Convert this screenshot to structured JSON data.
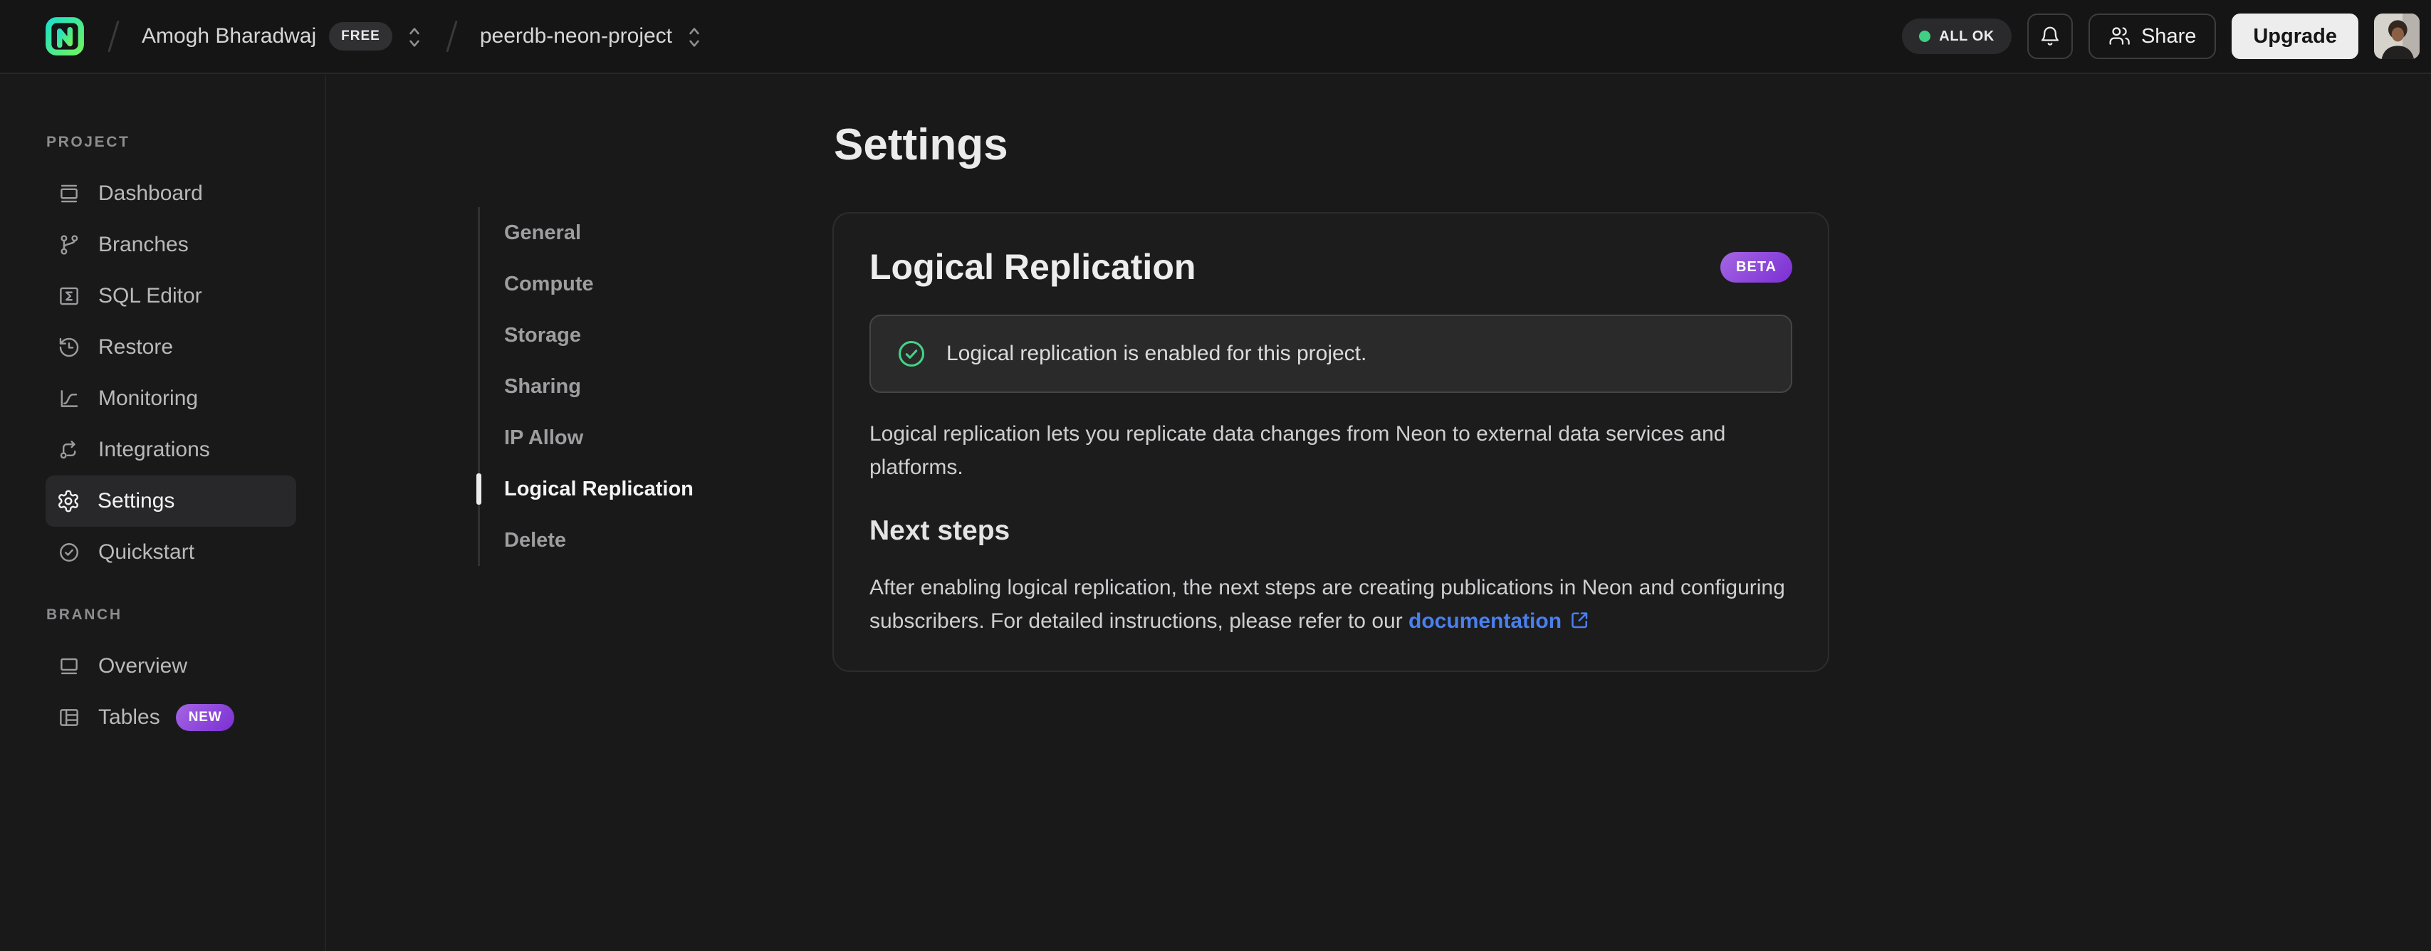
{
  "header": {
    "org_name": "Amogh Bharadwaj",
    "org_plan_badge": "FREE",
    "project_name": "peerdb-neon-project",
    "status_label": "ALL OK",
    "share_label": "Share",
    "upgrade_label": "Upgrade"
  },
  "sidebar": {
    "sections": [
      {
        "label": "PROJECT",
        "items": [
          {
            "label": "Dashboard"
          },
          {
            "label": "Branches"
          },
          {
            "label": "SQL Editor"
          },
          {
            "label": "Restore"
          },
          {
            "label": "Monitoring"
          },
          {
            "label": "Integrations"
          },
          {
            "label": "Settings"
          },
          {
            "label": "Quickstart"
          }
        ]
      },
      {
        "label": "BRANCH",
        "items": [
          {
            "label": "Overview"
          },
          {
            "label": "Tables",
            "badge": "NEW"
          }
        ]
      }
    ]
  },
  "settings_nav": {
    "items": [
      "General",
      "Compute",
      "Storage",
      "Sharing",
      "IP Allow",
      "Logical Replication",
      "Delete"
    ],
    "active": "Logical Replication"
  },
  "main": {
    "page_title": "Settings",
    "card": {
      "title": "Logical Replication",
      "badge": "BETA",
      "alert_text": "Logical replication is enabled for this project.",
      "description": "Logical replication lets you replicate data changes from Neon to external data services and platforms.",
      "next_steps_heading": "Next steps",
      "next_steps_text": "After enabling logical replication, the next steps are creating publications in Neon and configuring subscribers. For detailed instructions, please refer to our ",
      "doc_link_label": "documentation"
    }
  },
  "colors": {
    "success_green": "#42d483",
    "status_dot_green": "#41cf84",
    "badge_purple_start": "#a466e3",
    "badge_purple_end": "#7b2fd3",
    "link_blue": "#4a80ee",
    "upgrade_button_bg": "#ededee",
    "logo_gradient_start": "#1ee0c8",
    "logo_gradient_end": "#6ef35f"
  }
}
